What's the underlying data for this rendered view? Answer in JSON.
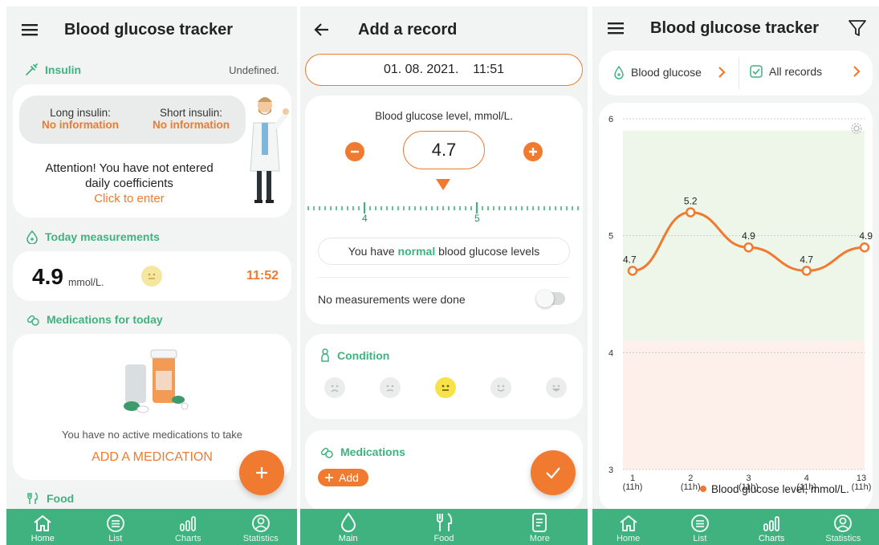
{
  "screen1": {
    "title": "Blood glucose tracker",
    "insulin": {
      "section_label": "Insulin",
      "status": "Undefined.",
      "long_label": "Long insulin:",
      "long_value": "No information",
      "short_label": "Short insulin:",
      "short_value": "No information",
      "attention_line1": "Attention! You have not entered",
      "attention_line2": "daily coefficients",
      "click_to_enter": "Click to enter"
    },
    "today": {
      "section_label": "Today measurements",
      "value": "4.9",
      "unit": "mmol/L.",
      "time": "11:52"
    },
    "medications": {
      "section_label": "Medications for today",
      "empty_text": "You have no active medications to take",
      "add_link": "ADD A MEDICATION"
    },
    "food": {
      "section_label": "Food"
    },
    "fab_icon": "plus-icon",
    "nav": [
      {
        "label": "Home",
        "icon": "home-icon"
      },
      {
        "label": "List",
        "icon": "list-icon"
      },
      {
        "label": "Charts",
        "icon": "charts-icon"
      },
      {
        "label": "Statistics",
        "icon": "statistics-icon"
      }
    ]
  },
  "screen2": {
    "title": "Add a record",
    "datetime": "01. 08. 2021.    11:51",
    "level_label": "Blood glucose level, mmol/L.",
    "value": "4.7",
    "ruler_labels": [
      "4",
      "5"
    ],
    "status_prefix": "You have ",
    "status_highlight": "normal",
    "status_suffix": " blood glucose levels",
    "no_measurements": "No measurements were done",
    "condition_label": "Condition",
    "medications_label": "Medications",
    "add_label": "Add",
    "fab_icon": "check-icon",
    "nav": [
      {
        "label": "Main",
        "icon": "drop-icon"
      },
      {
        "label": "Food",
        "icon": "food-icon"
      },
      {
        "label": "More",
        "icon": "more-icon"
      }
    ]
  },
  "screen3": {
    "title": "Blood glucose tracker",
    "filter_left": "Blood glucose",
    "filter_right": "All records",
    "nav": [
      {
        "label": "Home",
        "icon": "home-icon"
      },
      {
        "label": "List",
        "icon": "list-icon"
      },
      {
        "label": "Charts",
        "icon": "charts-icon"
      },
      {
        "label": "Statistics",
        "icon": "statistics-icon"
      }
    ]
  },
  "colors": {
    "accent_green": "#3fb27f",
    "accent_orange": "#f07a2f",
    "normal_band": "#eef6ea",
    "low_band": "#fdf0ea"
  },
  "chart_data": {
    "type": "line",
    "x_ticks": [
      "1\n(11h)",
      "2\n(11h)",
      "3\n(11h)",
      "4\n(11h)",
      "13\n(11h)"
    ],
    "series": [
      {
        "name": "Blood glucose level, mmol/L.",
        "values": [
          4.7,
          5.2,
          4.9,
          4.7,
          4.9
        ]
      }
    ],
    "data_labels": [
      "4.7",
      "5.2",
      "4.9",
      "4.7",
      "4.9"
    ],
    "y_ticks": [
      "6",
      "5",
      "4",
      "3"
    ],
    "ylim": [
      3,
      6
    ],
    "normal_range": [
      4.1,
      5.9
    ],
    "grid": true,
    "legend": "bottom-right"
  }
}
